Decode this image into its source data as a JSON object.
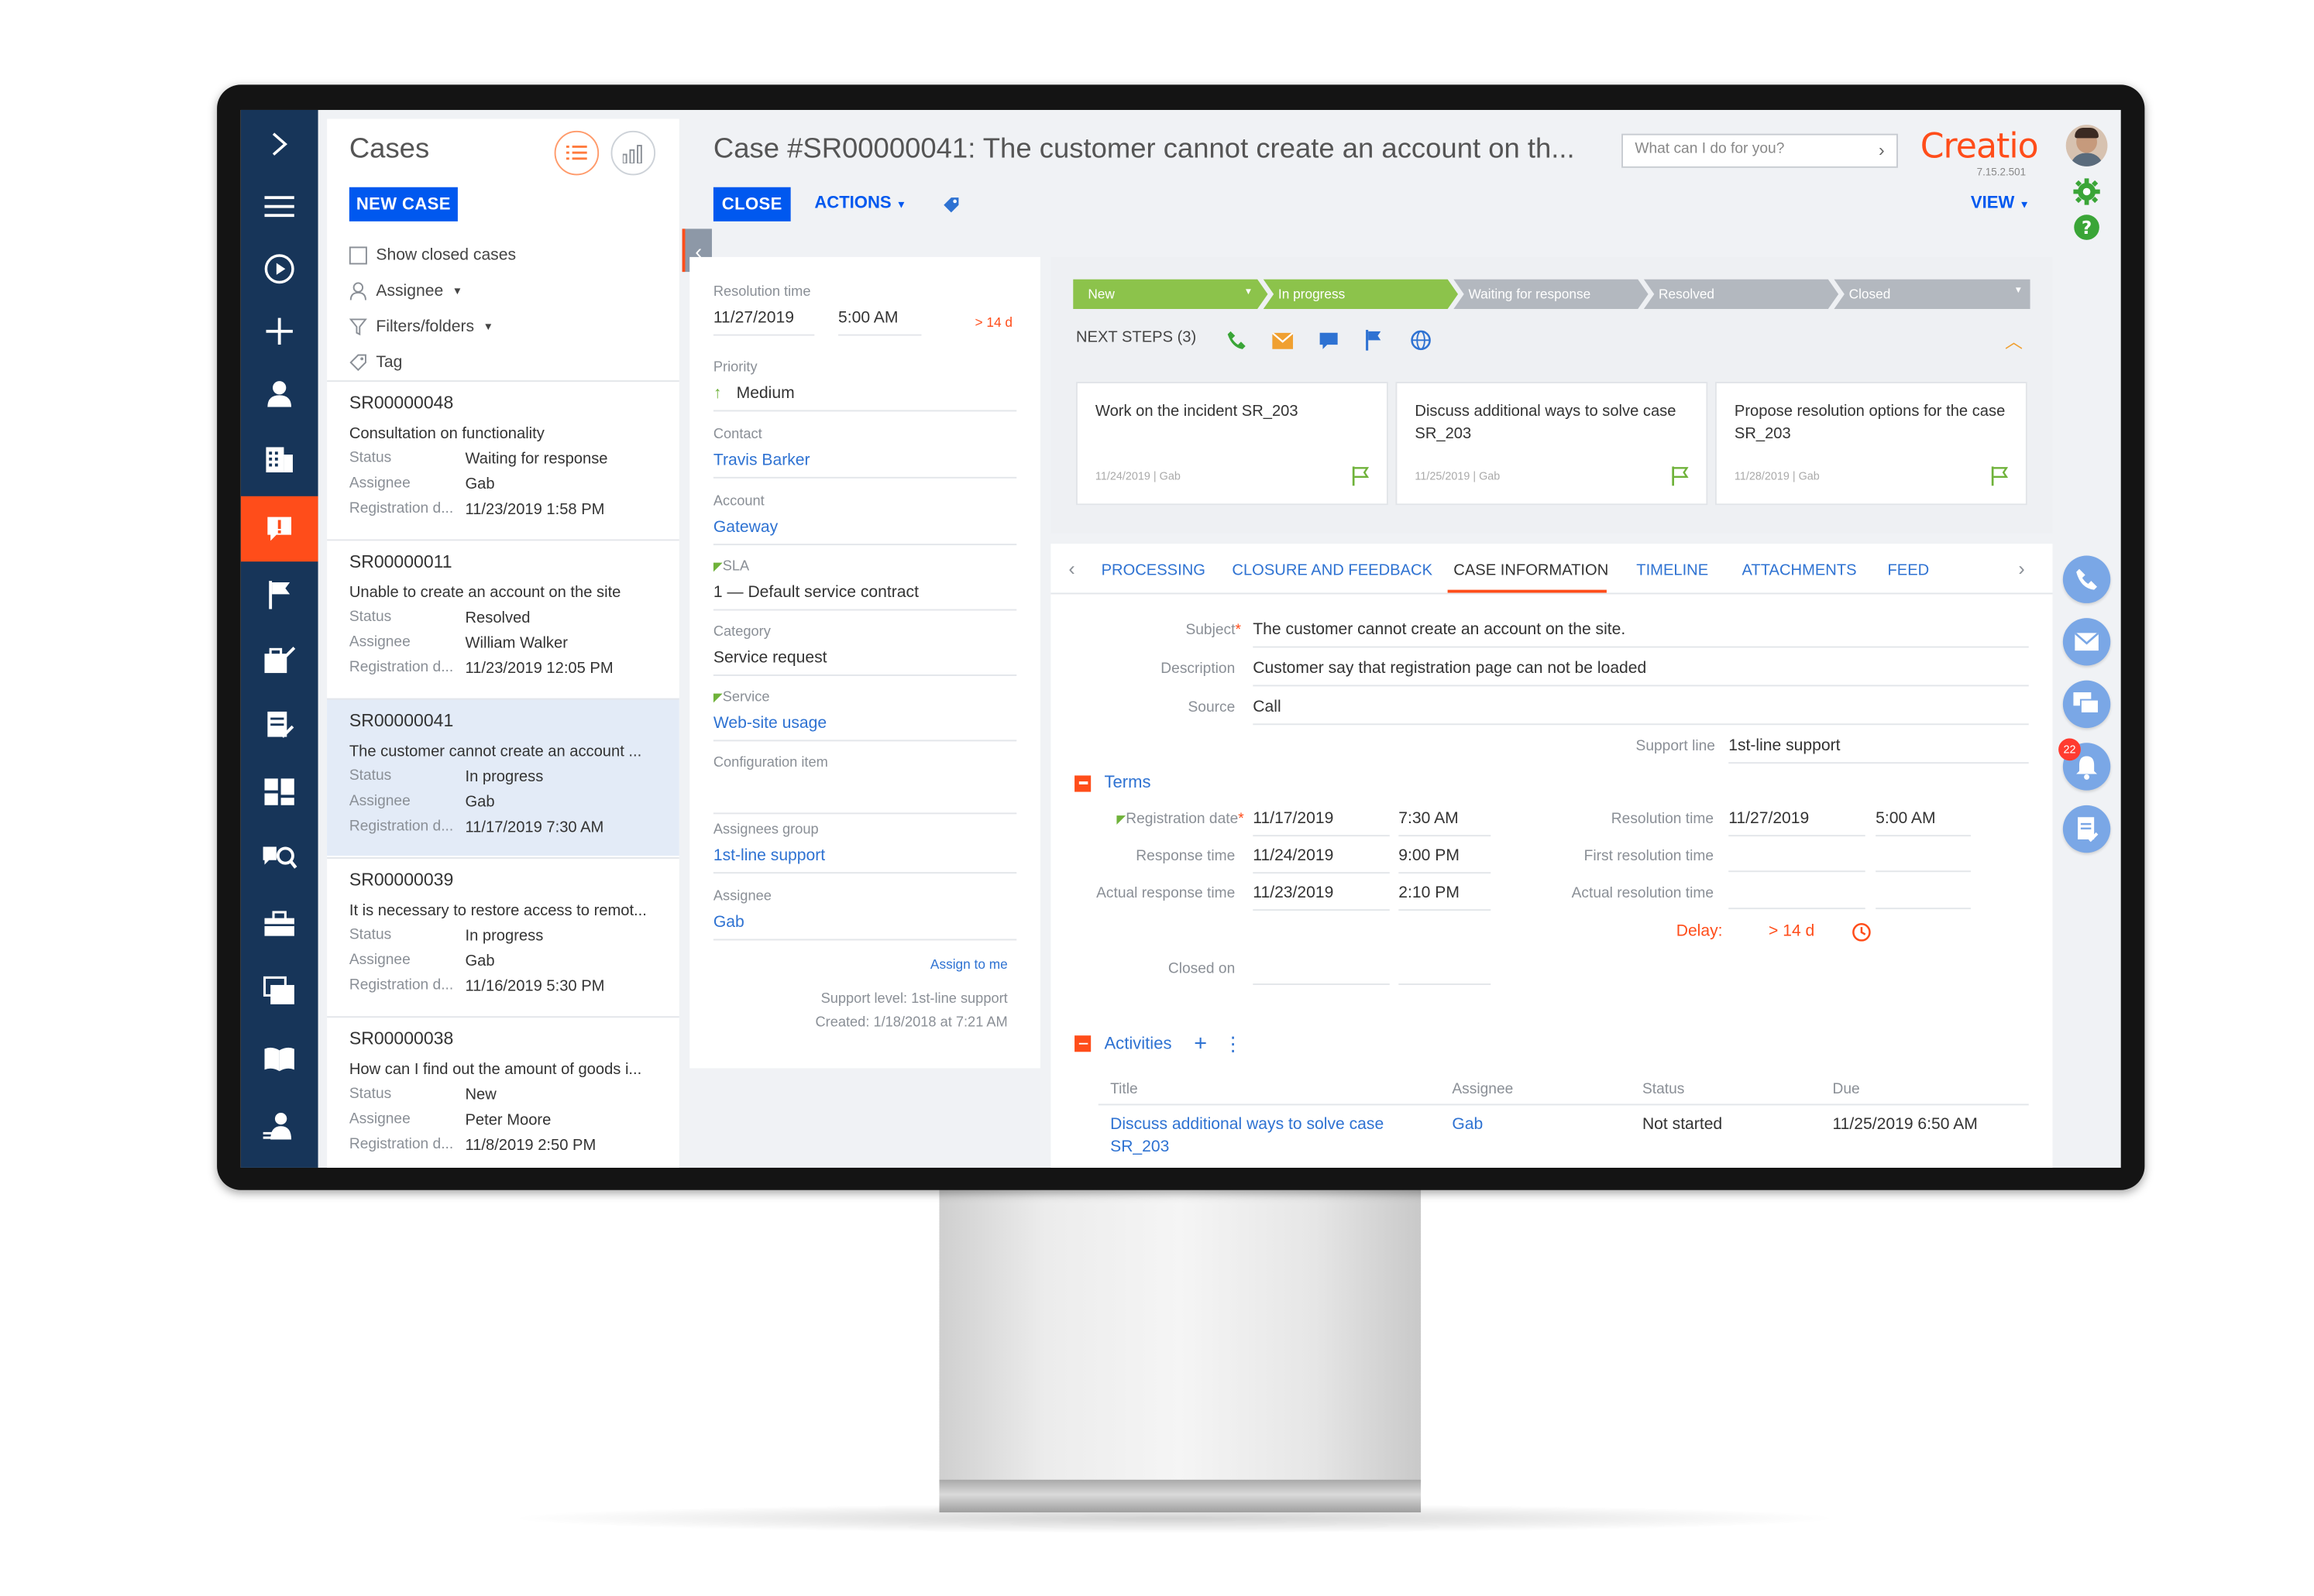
{
  "nav": {
    "items": [
      "toggle-icon",
      "menu-icon",
      "play-icon",
      "add-icon",
      "contacts-icon",
      "accounts-icon",
      "cases-icon",
      "flag-icon",
      "tools-icon",
      "document-icon",
      "dashboard-icon",
      "knowledge-search-icon",
      "briefcase-icon",
      "folders-icon",
      "book-icon",
      "users-icon"
    ],
    "active": "cases-icon"
  },
  "list": {
    "title": "Cases",
    "new_case": "NEW CASE",
    "show_closed": "Show closed cases",
    "assignee": "Assignee",
    "filters": "Filters/folders",
    "tag": "Tag",
    "labels": {
      "status": "Status",
      "assignee": "Assignee",
      "registration": "Registration d..."
    },
    "cases": [
      {
        "id": "SR00000048",
        "subject": "Consultation on functionality",
        "status": "Waiting for response",
        "assignee": "Gab",
        "registered": "11/23/2019 1:58 PM"
      },
      {
        "id": "SR00000011",
        "subject": "Unable to create an account on the site",
        "status": "Resolved",
        "assignee": "William Walker",
        "registered": "11/23/2019 12:05 PM"
      },
      {
        "id": "SR00000041",
        "subject": "The customer cannot create an account ...",
        "status": "In progress",
        "assignee": "Gab",
        "registered": "11/17/2019 7:30 AM"
      },
      {
        "id": "SR00000039",
        "subject": "It is necessary to restore access to remot...",
        "status": "In progress",
        "assignee": "Gab",
        "registered": "11/16/2019 5:30 PM"
      },
      {
        "id": "SR00000038",
        "subject": "How can I find out the amount of goods i...",
        "status": "New",
        "assignee": "Peter Moore",
        "registered": "11/8/2019 2:50 PM"
      }
    ]
  },
  "header": {
    "title": "Case #SR00000041: The customer cannot create an account on th...",
    "close": "CLOSE",
    "actions": "ACTIONS",
    "search_placeholder": "What can I do for you?",
    "logo": "Creatio",
    "version": "7.15.2.501",
    "view": "VIEW"
  },
  "details": {
    "resolution_time_label": "Resolution time",
    "resolution_date": "11/27/2019",
    "resolution_hour": "5:00 AM",
    "resolution_delay": "> 14 d",
    "priority_label": "Priority",
    "priority": "Medium",
    "contact_label": "Contact",
    "contact": "Travis Barker",
    "account_label": "Account",
    "account": "Gateway",
    "sla_label": "SLA",
    "sla": "1 — Default service contract",
    "category_label": "Category",
    "category": "Service request",
    "service_label": "Service",
    "service": "Web-site usage",
    "config_label": "Configuration item",
    "group_label": "Assignees group",
    "group": "1st-line support",
    "assignee_label": "Assignee",
    "assignee": "Gab",
    "assign_to_me": "Assign to me",
    "support_level": "Support level: 1st-line support",
    "created": "Created: 1/18/2018 at 7:21 AM"
  },
  "stages": {
    "items": [
      "New",
      "In progress",
      "Waiting for response",
      "Resolved",
      "Closed"
    ],
    "colors": {
      "done": "#8cc34b",
      "pending": "#b3b8bf"
    },
    "current_index": 1
  },
  "next_steps": {
    "label": "NEXT STEPS (3)",
    "tasks": [
      {
        "title": "Work on the incident SR_203",
        "date": "11/24/2019",
        "owner": "Gab"
      },
      {
        "title": "Discuss additional ways to solve case SR_203",
        "date": "11/25/2019",
        "owner": "Gab"
      },
      {
        "title": "Propose resolution options for the case SR_203",
        "date": "11/28/2019",
        "owner": "Gab"
      }
    ]
  },
  "tabs": {
    "items": [
      "PROCESSING",
      "CLOSURE AND FEEDBACK",
      "CASE INFORMATION",
      "TIMELINE",
      "ATTACHMENTS",
      "FEED"
    ],
    "active": "CASE INFORMATION"
  },
  "case_info": {
    "subject_label": "Subject",
    "subject": "The customer cannot create an account on the site.",
    "description_label": "Description",
    "description": "Customer say that registration page can not be loaded",
    "source_label": "Source",
    "source": "Call",
    "support_line_label": "Support line",
    "support_line": "1st-line support"
  },
  "terms": {
    "title": "Terms",
    "registration_label": "Registration date",
    "registration_date": "11/17/2019",
    "registration_time": "7:30 AM",
    "response_label": "Response time",
    "response_date": "11/24/2019",
    "response_time": "9:00 PM",
    "actual_response_label": "Actual response time",
    "actual_response_date": "11/23/2019",
    "actual_response_time": "2:10 PM",
    "closed_label": "Closed on",
    "resolution_label": "Resolution time",
    "resolution_date": "11/27/2019",
    "resolution_time": "5:00 AM",
    "first_resolution_label": "First resolution time",
    "actual_resolution_label": "Actual resolution time",
    "delay_label": "Delay:",
    "delay_value": "> 14 d"
  },
  "activities": {
    "title": "Activities",
    "columns": [
      "Title",
      "Assignee",
      "Status",
      "Due"
    ],
    "row": {
      "title": "Discuss additional ways to solve case SR_203",
      "assignee": "Gab",
      "status": "Not started",
      "due": "11/25/2019 6:50 AM"
    }
  },
  "rail": {
    "notifications": "22"
  },
  "colors": {
    "nav": "#173559",
    "accent": "#ff4d1a",
    "primary": "#0058ef",
    "link": "#2e72d2"
  }
}
